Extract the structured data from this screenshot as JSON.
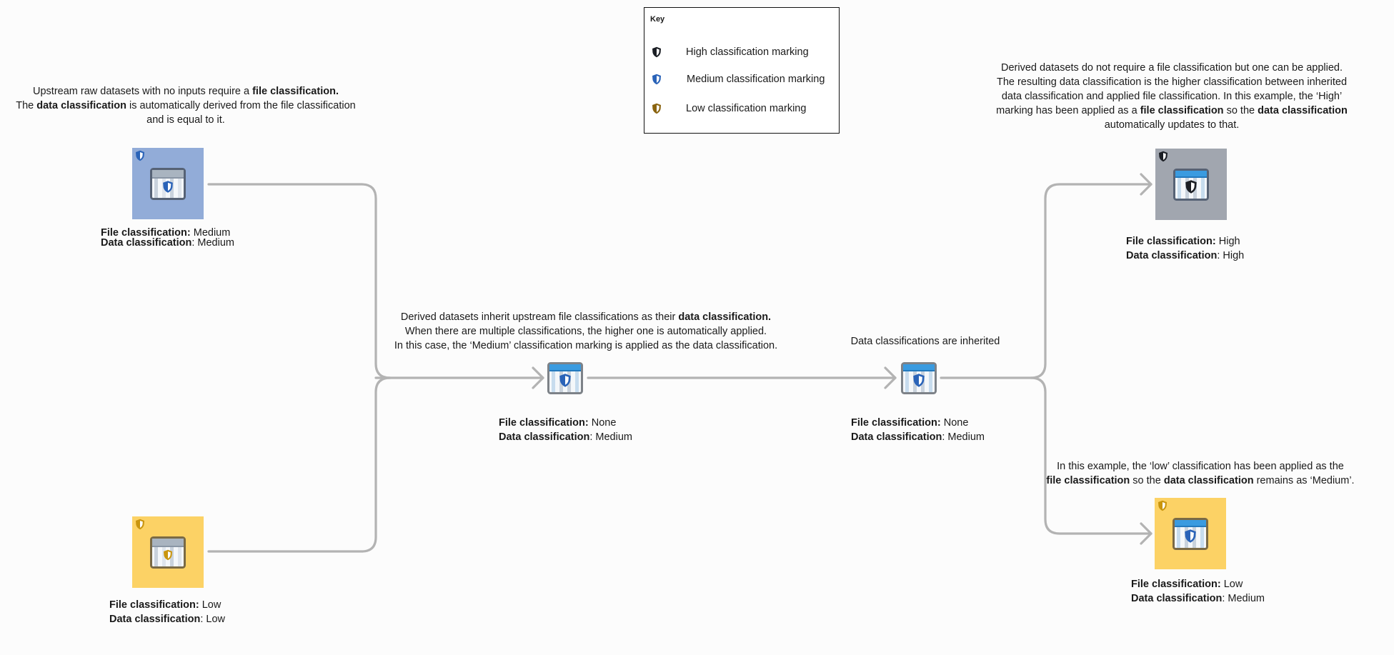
{
  "colors": {
    "high": "#1b1e24",
    "medium": "#2a63b8",
    "low": "#c9950e",
    "low_key": "#8a6410",
    "box_medium": "#92acd8",
    "box_high": "#a1a6af",
    "box_low": "#fcd265",
    "edge": "#b3b3b3",
    "icon_header_raw": "#a9b4c0",
    "icon_header_derived": "#3a9be0"
  },
  "key": {
    "title": "Key",
    "items": [
      {
        "icon": "high-shield-icon",
        "level": "high",
        "label": "High classification marking"
      },
      {
        "icon": "medium-shield-icon",
        "level": "medium",
        "label": "Medium classification marking"
      },
      {
        "icon": "low-shield-icon",
        "level": "low",
        "label": "Low classification marking"
      }
    ]
  },
  "captions": {
    "raw": {
      "l1a": "Upstream raw datasets with no inputs require a ",
      "l1b": "file classification.",
      "l2a": "The ",
      "l2b": "data classification",
      "l2c": " is automatically derived from the file classification",
      "l3": "and is equal to it."
    },
    "derived": {
      "l1a": "Derived datasets inherit upstream file classifications as their ",
      "l1b": "data classification.",
      "l2": "When there are multiple classifications, the higher one is automatically applied.",
      "l3": "In this case, the ‘Medium’ classification marking is applied as the data classification."
    },
    "inherited": "Data classifications are  inherited",
    "high_branch": {
      "l1": "Derived datasets do not require a file classification but one can be applied.",
      "l2": "The resulting data classification is the higher classification between inherited",
      "l3": "data classification and applied file classification. In this example, the ‘High’",
      "l4a": "marking has been applied as a ",
      "l4b": "file classification",
      "l4c": " so the ",
      "l4d": "data classification",
      "l5": "automatically updates to that."
    },
    "low_branch": {
      "l1": "In this example, the ‘low’ classification has been applied as the",
      "l2a": "file classification",
      "l2b": " so the  ",
      "l2c": "data classification",
      "l2d": " remains as ‘Medium’."
    }
  },
  "label_keys": {
    "file": "File classification:",
    "data": "Data classification"
  },
  "nodes": {
    "raw_medium": {
      "file": " Medium",
      "data": ": Medium",
      "marking": "medium"
    },
    "raw_low": {
      "file": " Low",
      "data": ": Low",
      "marking": "low"
    },
    "derived_1": {
      "file": " None",
      "data": ": Medium",
      "marking": "medium"
    },
    "derived_2": {
      "file": " None",
      "data": ": Medium",
      "marking": "medium"
    },
    "derived_high": {
      "file": " High",
      "data": ": High",
      "marking": "high"
    },
    "derived_low": {
      "file": " Low",
      "data": ": Medium",
      "marking": "low"
    }
  }
}
